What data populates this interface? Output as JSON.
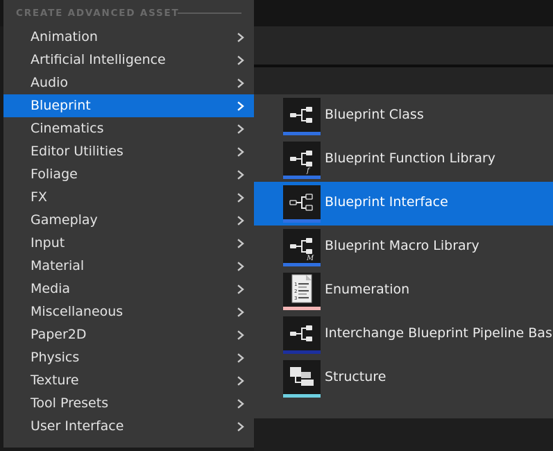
{
  "menu": {
    "header": "CREATE ADVANCED ASSET",
    "items": [
      {
        "label": "Animation"
      },
      {
        "label": "Artificial Intelligence"
      },
      {
        "label": "Audio"
      },
      {
        "label": "Blueprint",
        "selected": true
      },
      {
        "label": "Cinematics"
      },
      {
        "label": "Editor Utilities"
      },
      {
        "label": "Foliage"
      },
      {
        "label": "FX"
      },
      {
        "label": "Gameplay"
      },
      {
        "label": "Input"
      },
      {
        "label": "Material"
      },
      {
        "label": "Media"
      },
      {
        "label": "Miscellaneous"
      },
      {
        "label": "Paper2D"
      },
      {
        "label": "Physics"
      },
      {
        "label": "Texture"
      },
      {
        "label": "Tool Presets"
      },
      {
        "label": "User Interface"
      }
    ]
  },
  "submenu": {
    "items": [
      {
        "label": "Blueprint Class",
        "icon": "blueprint-node-icon",
        "stripe": "#2f6fe0"
      },
      {
        "label": "Blueprint Function Library",
        "icon": "blueprint-function-icon",
        "glyph": "f",
        "stripe": "#2f6fe0"
      },
      {
        "label": "Blueprint Interface",
        "icon": "blueprint-interface-icon",
        "stripe": "#2f6fe0",
        "selected": true
      },
      {
        "label": "Blueprint Macro Library",
        "icon": "blueprint-macro-icon",
        "glyph": "M",
        "stripe": "#2f6fe0"
      },
      {
        "label": "Enumeration",
        "icon": "enumeration-list-icon",
        "stripe": "#f3b5b5"
      },
      {
        "label": "Interchange Blueprint Pipeline Base",
        "icon": "blueprint-node-icon",
        "stripe": "#1c2f9e"
      },
      {
        "label": "Structure",
        "icon": "structure-icon",
        "stripe": "#6dcfe0"
      }
    ]
  },
  "colors": {
    "selection": "#0f6fd7",
    "menu_bg": "#383838",
    "text": "#e4e4e4"
  }
}
